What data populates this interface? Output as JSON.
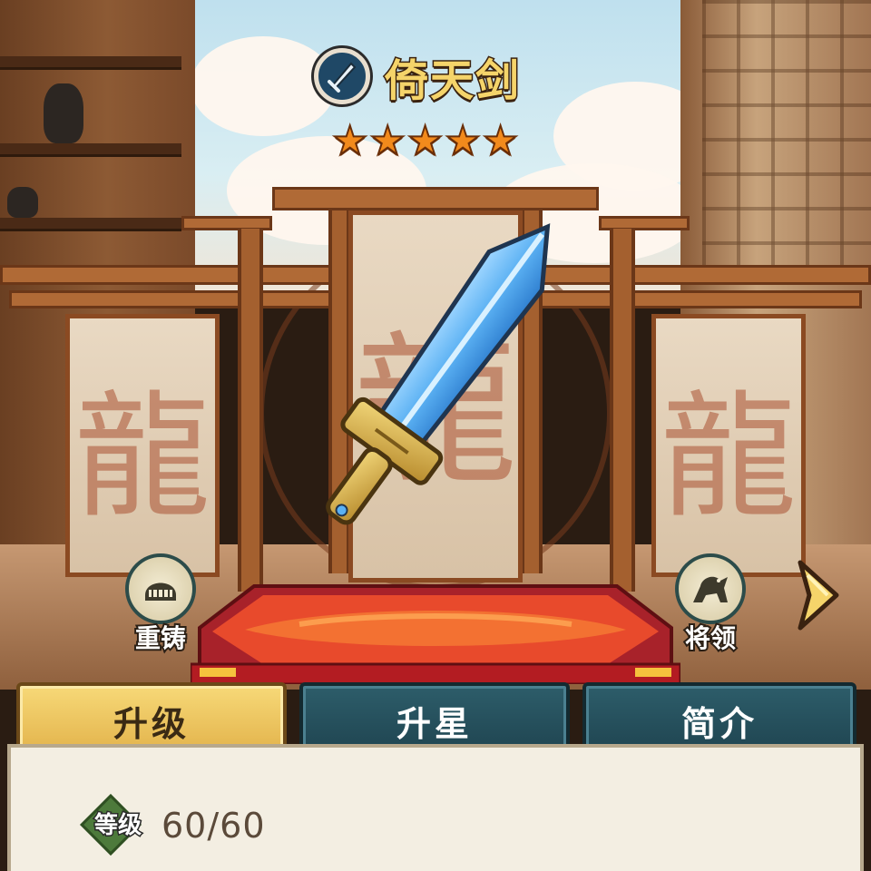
{
  "item": {
    "name": "倚天剑",
    "type_icon": "sword-icon",
    "stars": 5,
    "star_glyph": "★"
  },
  "side_buttons": {
    "recast": {
      "label": "重铸",
      "icon": "helmet-icon"
    },
    "general": {
      "label": "将领",
      "icon": "lion-icon"
    }
  },
  "tabs": [
    {
      "label": "升级",
      "active": true
    },
    {
      "label": "升星",
      "active": false
    },
    {
      "label": "简介",
      "active": false
    }
  ],
  "stats": {
    "level_label": "等级",
    "level_value": "60/60"
  },
  "colors": {
    "title_gold": "#f5d46a",
    "star_orange": "#f28a1c",
    "tab_active": "#e2b24a",
    "tab_inactive": "#1f4450",
    "panel_bg": "#f3eee2"
  }
}
